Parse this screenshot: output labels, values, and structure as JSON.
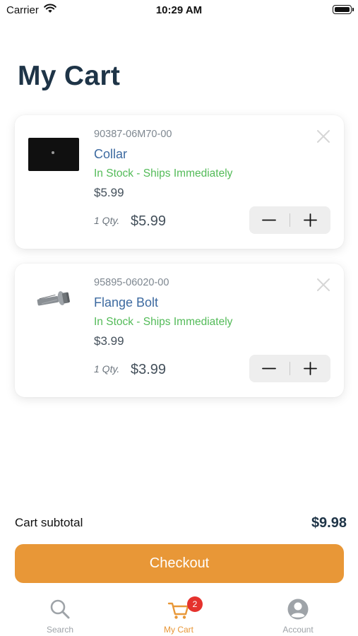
{
  "status_bar": {
    "carrier": "Carrier",
    "time": "10:29 AM"
  },
  "page": {
    "title": "My Cart"
  },
  "cart_items": [
    {
      "part_number": "90387-06M70-00",
      "name": "Collar",
      "stock": "In Stock - Ships Immediately",
      "unit_price": "$5.99",
      "qty_label": "1 Qty.",
      "line_total": "$5.99",
      "image_icon": "collar-image"
    },
    {
      "part_number": "95895-06020-00",
      "name": "Flange Bolt",
      "stock": "In Stock - Ships Immediately",
      "unit_price": "$3.99",
      "qty_label": "1 Qty.",
      "line_total": "$3.99",
      "image_icon": "flange-bolt-image"
    }
  ],
  "summary": {
    "subtotal_label": "Cart subtotal",
    "subtotal_value": "$9.98"
  },
  "checkout": {
    "label": "Checkout"
  },
  "tabbar": {
    "items": [
      {
        "label": "Search",
        "icon": "search-icon"
      },
      {
        "label": "My Cart",
        "icon": "cart-icon",
        "badge": "2",
        "active": true
      },
      {
        "label": "Account",
        "icon": "account-icon"
      }
    ]
  },
  "colors": {
    "accent": "#e89737",
    "title": "#1e3447",
    "product_link": "#3d6aa0",
    "in_stock": "#53bb58",
    "badge": "#e5322d",
    "tab_inactive": "#9ea3a8"
  }
}
